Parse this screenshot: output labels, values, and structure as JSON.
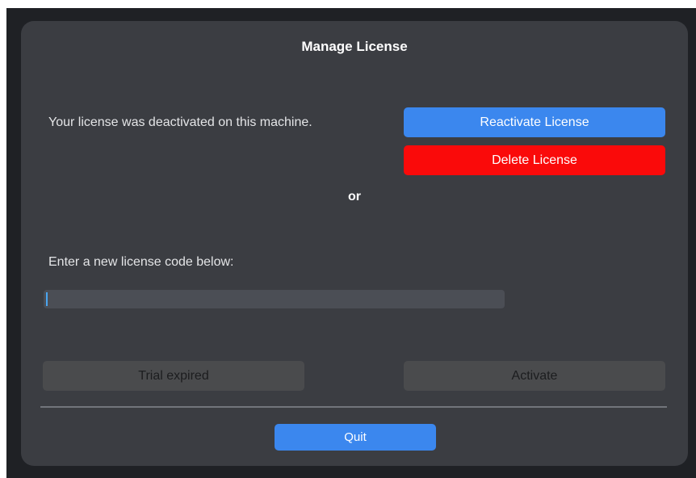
{
  "dialog": {
    "title": "Manage License",
    "status_message": "Your license was deactivated on this machine.",
    "reactivate_label": "Reactivate License",
    "delete_label": "Delete License",
    "separator_text": "or",
    "prompt_message": "Enter a new license code below:",
    "license_input": {
      "value": "",
      "placeholder": ""
    },
    "trial_label": "Trial expired",
    "activate_label": "Activate",
    "quit_label": "Quit"
  },
  "colors": {
    "dialog_background": "#3b3d42",
    "primary_button": "#3b87ee",
    "danger_button": "#fa0a0a",
    "disabled_button": "#4a4b4d",
    "input_background": "#4b4e55"
  }
}
